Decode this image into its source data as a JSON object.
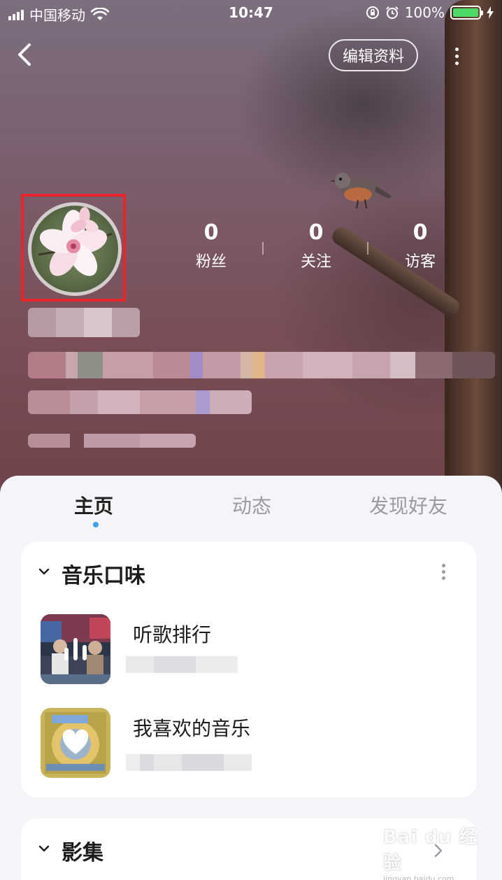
{
  "status_bar": {
    "carrier": "中国移动",
    "time": "10:47",
    "battery": "100%",
    "battery_level": 1.0
  },
  "nav": {
    "edit_profile": "编辑资料"
  },
  "stats": [
    {
      "value": "0",
      "label": "粉丝"
    },
    {
      "value": "0",
      "label": "关注"
    },
    {
      "value": "0",
      "label": "访客"
    }
  ],
  "tabs": [
    {
      "label": "主页",
      "active": true
    },
    {
      "label": "动态",
      "active": false
    },
    {
      "label": "发现好友",
      "active": false
    }
  ],
  "music_section": {
    "title": "音乐口味",
    "items": [
      {
        "title": "听歌排行",
        "icon": "sound-wave-icon"
      },
      {
        "title": "我喜欢的音乐",
        "icon": "heart-icon"
      }
    ]
  },
  "album_section": {
    "title": "影集"
  },
  "watermark": {
    "logo": "Bai du 经验",
    "url": "jingyan.baidu.com"
  },
  "colors": {
    "highlight_box": "#e8242c",
    "active_tab_dot": "#3d9ff0",
    "battery_fill": "#4cd964"
  }
}
